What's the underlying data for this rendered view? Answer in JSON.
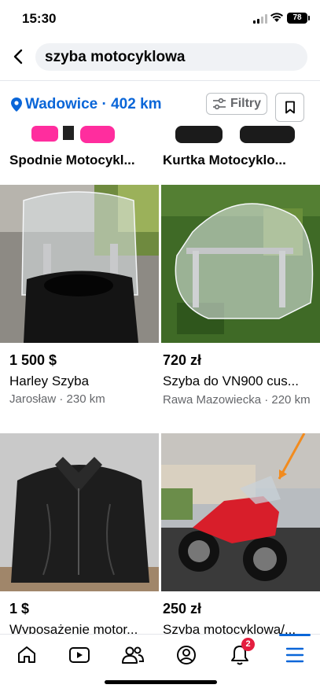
{
  "status": {
    "time": "15:30",
    "battery": "78"
  },
  "search": {
    "query": "szyba motocyklowa"
  },
  "location": {
    "label": "Wadowice · 402 km"
  },
  "filters": {
    "label": "Filtry"
  },
  "listings_top": [
    {
      "title": "Spodnie Motocykl..."
    },
    {
      "title": "Kurtka Motocyklo..."
    }
  ],
  "listings": [
    {
      "price": "1 500 $",
      "title": "Harley Szyba",
      "location": "Jarosław · 230 km"
    },
    {
      "price": "720 zł",
      "title": "Szyba do VN900 cus...",
      "location": "Rawa Mazowiecka · 220 km"
    },
    {
      "price": "1 $",
      "title": "Wyposażenie motor..."
    },
    {
      "price": "250 zł",
      "title": "Szyba motocyklowa/..."
    }
  ],
  "nav": {
    "notifications_badge": "2"
  },
  "colors": {
    "accent": "#0a66d8",
    "badge": "#e41e3f",
    "muted": "#65676b"
  }
}
